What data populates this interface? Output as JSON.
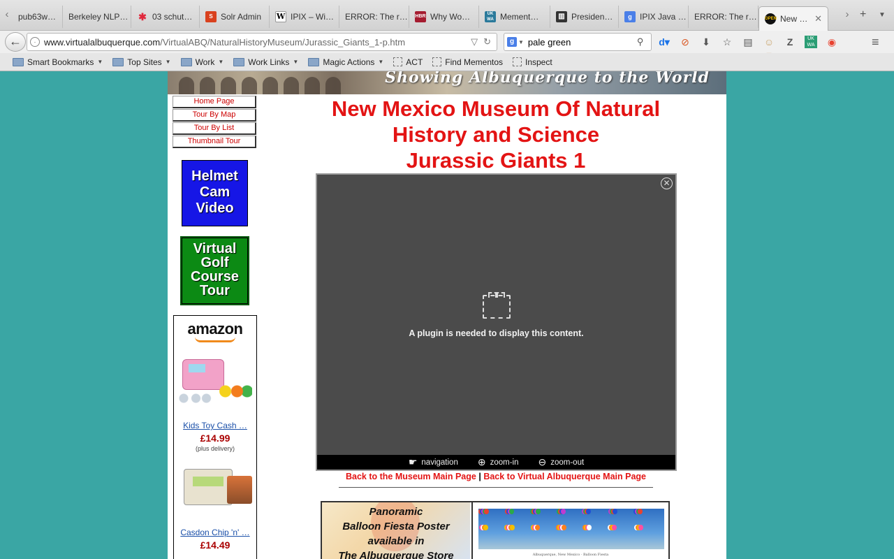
{
  "browser": {
    "tabs": [
      {
        "title": "pub63w…",
        "favicon": "document-icon",
        "color": "#888888"
      },
      {
        "title": "Berkeley NLP…",
        "favicon": "blank-icon",
        "color": "#cccccc"
      },
      {
        "title": "03 schut…",
        "favicon": "cluster-icon",
        "color": "#e0283c"
      },
      {
        "title": "Solr Admin",
        "favicon": "solr-icon",
        "color": "#d9411e"
      },
      {
        "title": "IPIX – Wi…",
        "favicon": "wikipedia-icon",
        "color": "#ffffff"
      },
      {
        "title": "ERROR: The r…",
        "favicon": "blank-icon",
        "color": "#cccccc"
      },
      {
        "title": "Why Wo…",
        "favicon": "hbr-icon",
        "color": "#a51c30"
      },
      {
        "title": "Mement…",
        "favicon": "ukwa-icon",
        "color": "#2b7a9b"
      },
      {
        "title": "Presiden…",
        "favicon": "building-icon",
        "color": "#333333"
      },
      {
        "title": "IPIX Java …",
        "favicon": "google-icon",
        "color": "#4a7fe8"
      },
      {
        "title": "ERROR: The r…",
        "favicon": "blank-icon",
        "color": "#cccccc"
      },
      {
        "title": "New …",
        "favicon": "open-sign-icon",
        "color": "#f3c000"
      }
    ],
    "url": {
      "host": "www.virtualalbuquerque.com",
      "path": "/VirtualABQ/NaturalHistoryMuseum/Jurassic_Giants_1-p.htm"
    },
    "search": {
      "value": "pale green",
      "engine": "google-icon"
    },
    "bookmarks": [
      {
        "label": "Smart Bookmarks",
        "type": "folder",
        "dropdown": true
      },
      {
        "label": "Top Sites",
        "type": "folder",
        "dropdown": true
      },
      {
        "label": "Work",
        "type": "folder",
        "dropdown": true
      },
      {
        "label": "Work Links",
        "type": "folder",
        "dropdown": true
      },
      {
        "label": "Magic Actions",
        "type": "folder",
        "dropdown": true
      },
      {
        "label": "ACT",
        "type": "bookmarklet",
        "dropdown": false
      },
      {
        "label": "Find Mementos",
        "type": "bookmarklet",
        "dropdown": false
      },
      {
        "label": "Inspect",
        "type": "bookmarklet",
        "dropdown": false
      }
    ],
    "toolbar_icons": [
      "instapaper-icon",
      "adblock-icon",
      "download-icon",
      "star-icon",
      "reader-icon",
      "persona-icon",
      "zotero-icon",
      "ukwa-icon",
      "pocket-icon"
    ]
  },
  "page": {
    "banner_text": "Showing Albuquerque to the World",
    "sidenav": [
      "Home Page",
      "Tour By Map",
      "Tour By List",
      "Thumbnail Tour"
    ],
    "promos": {
      "helmet": [
        "Helmet",
        "Cam",
        "Video"
      ],
      "golf": [
        "Virtual",
        "Golf",
        "Course",
        "Tour"
      ],
      "colors": {
        "helmet": "#1616e6",
        "golf": "#0c8a14"
      }
    },
    "amazon": {
      "logo": "amazon",
      "products": [
        {
          "name": "Kids Toy Cash …",
          "price": "£14.99",
          "delivery": "(plus delivery)"
        },
        {
          "name": "Casdon Chip 'n' …",
          "price": "£14.49"
        }
      ]
    },
    "title_lines": [
      "New Mexico Museum Of Natural",
      "History and Science",
      "Jurassic Giants 1"
    ],
    "plugin": {
      "message": "A plugin is needed to display this content.",
      "controls": [
        {
          "label": "navigation",
          "icon": "hand-icon"
        },
        {
          "label": "zoom-in",
          "icon": "zoom-in-icon"
        },
        {
          "label": "zoom-out",
          "icon": "zoom-out-icon"
        }
      ]
    },
    "backlinks": {
      "museum": "Back to the Museum Main Page",
      "separator": "|",
      "main": "Back to Virtual Albuquerque Main Page"
    },
    "poster": {
      "lines": [
        "Panoramic",
        "Balloon Fiesta Poster",
        "available in",
        "The Albuquerque Store"
      ],
      "caption": "Albuquerque, New Mexico · Balloon Fiesta"
    }
  },
  "colors": {
    "background": "#3aa6a4",
    "title_red": "#e31414",
    "link_red": "#cc0000",
    "plugin_bg": "#4b4b4b"
  }
}
